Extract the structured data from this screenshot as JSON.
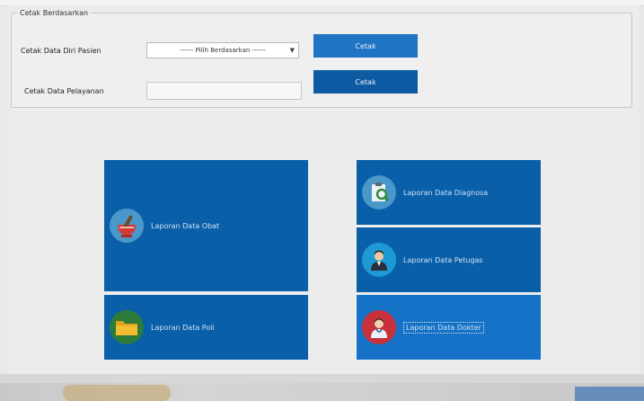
{
  "filter_group": {
    "title": "Cetak Berdasarkan",
    "rows": [
      {
        "label": "Cetak Data Diri Pasien",
        "select_value": "------ Pilih Berdasarkan ------",
        "button_label": "Cetak"
      },
      {
        "label": "Cetak Data Pelayanan",
        "input_value": "",
        "button_label": "Cetak"
      }
    ]
  },
  "tiles": [
    {
      "label": "Laporan Data Obat",
      "icon": "mortar-pestle-icon"
    },
    {
      "label": "Laporan Data Poli",
      "icon": "folder-icon"
    },
    {
      "label": "Laporan Data Diagnosa",
      "icon": "clipboard-search-icon"
    },
    {
      "label": "Laporan Data Petugas",
      "icon": "officer-icon"
    },
    {
      "label": "Laporan Data Dokter",
      "icon": "doctor-icon"
    }
  ],
  "colors": {
    "tile_blue": "#0a5fa9",
    "tile_selected": "#1572c6",
    "button_blue": "#1f74c4"
  }
}
